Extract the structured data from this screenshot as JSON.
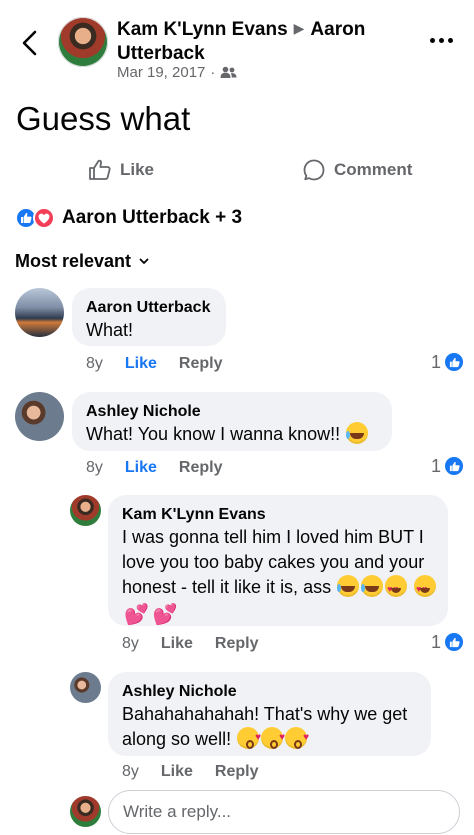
{
  "header": {
    "author": "Kam K'Lynn Evans",
    "target": "Aaron Utterback",
    "date": "Mar 19, 2017",
    "separator": "·",
    "audience_icon": "friends-icon"
  },
  "post": {
    "text": "Guess what"
  },
  "actions": {
    "like": "Like",
    "comment": "Comment"
  },
  "reactions": {
    "summary": "Aaron Utterback + 3",
    "icons": [
      "like-reaction-icon",
      "love-reaction-icon"
    ]
  },
  "sort": {
    "label": "Most relevant"
  },
  "comments": [
    {
      "name": "Aaron Utterback",
      "text": "What!",
      "emoji": [],
      "age": "8y",
      "like": "Like",
      "reply": "Reply",
      "count": "1",
      "liked": true
    },
    {
      "name": "Ashley Nichole",
      "text": "What! You know I wanna know!!",
      "emoji": [
        "laughing-crying"
      ],
      "age": "8y",
      "like": "Like",
      "reply": "Reply",
      "count": "1",
      "liked": true
    },
    {
      "name": "Kam K'Lynn Evans",
      "text": "I was gonna tell him I loved him BUT I love you too baby cakes you and your honest - tell it like it is, ass",
      "emoji": [
        "laughing-crying",
        "laughing-crying",
        "heart-eyes",
        "heart-eyes",
        "two-hearts",
        "two-hearts"
      ],
      "age": "8y",
      "like": "Like",
      "reply": "Reply",
      "count": "1",
      "liked": false
    },
    {
      "name": "Ashley Nichole",
      "text": "Bahahahahahah! That's why we get along so well!",
      "emoji": [
        "kissing-heart",
        "kissing-heart",
        "kissing-heart"
      ],
      "age": "8y",
      "like": "Like",
      "reply": "Reply",
      "count": "",
      "liked": false
    }
  ],
  "composer": {
    "placeholder": "Write a reply..."
  },
  "colors": {
    "accent": "#1877f2",
    "love": "#f33e58",
    "bubble": "#f0f2f5",
    "muted": "#65676b"
  }
}
